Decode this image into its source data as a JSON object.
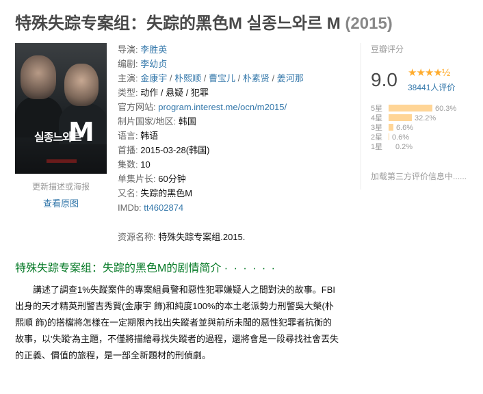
{
  "title": {
    "main": "特殊失踪专案组：失踪的黑色M 실종느와르 M",
    "year": "(2015)"
  },
  "poster": {
    "korean_title": "실종느와르",
    "letter": "M",
    "update_text": "更新描述或海报",
    "view_original": "查看原图"
  },
  "info": {
    "director_label": "导演:",
    "director": "李胜英",
    "writer_label": "编剧:",
    "writer": "李幼贞",
    "cast_label": "主演:",
    "cast": [
      "金康宇",
      "朴熙顺",
      "曹宝儿",
      "朴素贤",
      "姜河那"
    ],
    "cast_sep": " / ",
    "genre_label": "类型:",
    "genre": "动作 / 悬疑 / 犯罪",
    "site_label": "官方网站:",
    "site": "program.interest.me/ocn/m2015/",
    "country_label": "制片国家/地区:",
    "country": "韩国",
    "language_label": "语言:",
    "language": "韩语",
    "premiere_label": "首播:",
    "premiere": "2015-03-28(韩国)",
    "episodes_label": "集数:",
    "episodes": "10",
    "runtime_label": "单集片长:",
    "runtime": "60分钟",
    "aka_label": "又名:",
    "aka": "失踪的黑色M",
    "imdb_label": "IMDb:",
    "imdb": "tt4602874"
  },
  "resource": {
    "label": "资源名称:",
    "value": "特殊失踪专案组.2015."
  },
  "rating": {
    "header": "豆瓣评分",
    "score": "9.0",
    "stars": "★★★★½",
    "count": "38441人评价",
    "distribution": [
      {
        "label": "5星",
        "percent": "60.3%",
        "value": 60.3
      },
      {
        "label": "4星",
        "percent": "32.2%",
        "value": 32.2
      },
      {
        "label": "3星",
        "percent": "6.6%",
        "value": 6.6
      },
      {
        "label": "2星",
        "percent": "0.6%",
        "value": 0.6
      },
      {
        "label": "1星",
        "percent": "0.2%",
        "value": 0.2
      }
    ],
    "third_party": "加载第三方评价信息中......"
  },
  "summary": {
    "heading": "特殊失踪专案组：失踪的黑色M的剧情简介",
    "dots": "· · · · · ·",
    "text": "講述了調查1%失蹤案件的專案組員警和惡性犯罪嫌疑人之間對決的故事。FBI出身的天才精英刑警吉秀賢(金康宇 飾)和純度100%的本土老派勢力刑警吳大榮(朴熙順 飾)的搭檔將怎樣在一定期限內找出失蹤者並與前所未聞的惡性犯罪者抗衡的故事，以'失蹤'為主題，不僅將描繪尋找失蹤者的過程，還將會是一段尋找社會丟失的正義、價值的旅程，是一部全新題材的刑偵劇。"
  }
}
